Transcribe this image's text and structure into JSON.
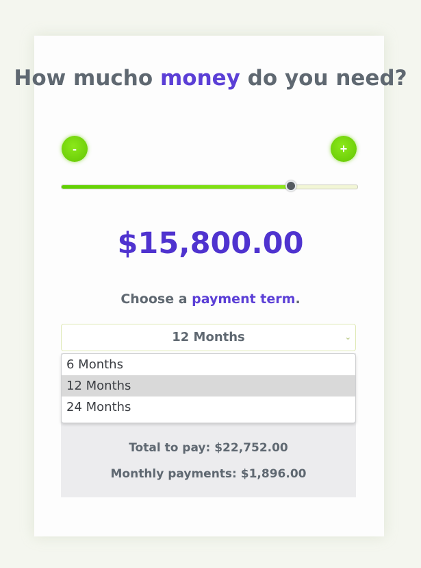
{
  "heading": {
    "part1": "How mucho ",
    "highlight": "money",
    "part2": " do you need?"
  },
  "controls": {
    "decrease_label": "-",
    "increase_label": "+"
  },
  "slider": {
    "fraction": 0.775
  },
  "amount": "$15,800.00",
  "term_prompt": {
    "part1": "Choose a ",
    "highlight": "payment term",
    "part2": "."
  },
  "select": {
    "value": "12 Months",
    "chevron_icon": "chevron-down-icon",
    "options": [
      "6 Months",
      "12 Months",
      "24 Months"
    ],
    "highlighted_option": "12 Months"
  },
  "results": {
    "term": "12 Months",
    "total": "Total to pay: $22,752.00",
    "monthly": "Monthly payments: $1,896.00"
  },
  "colors": {
    "accent_purple": "#5b3fd6",
    "accent_green": "#6fd00a",
    "text_gray": "#5f6871"
  }
}
